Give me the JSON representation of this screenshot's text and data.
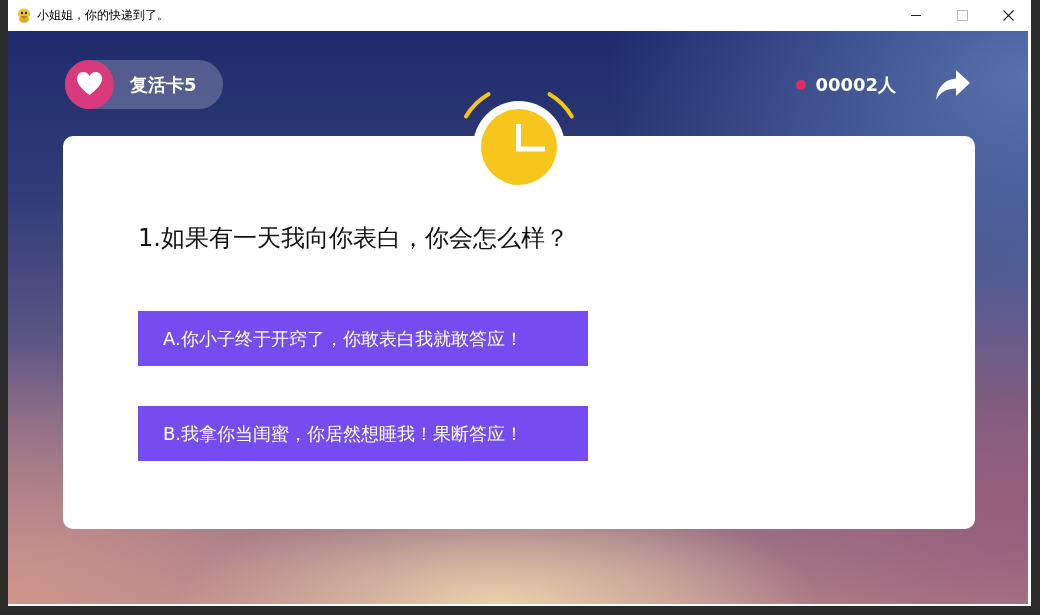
{
  "window": {
    "title": "小姐姐，你的快递到了。"
  },
  "header": {
    "revive_cards": "复活卡5",
    "player_count": "00002人"
  },
  "question": {
    "text": "1.如果有一天我向你表白，你会怎么样？"
  },
  "options": [
    {
      "label": "A.你小子终于开窍了，你敢表白我就敢答应！"
    },
    {
      "label": "B.我拿你当闺蜜，你居然想睡我！果断答应！"
    }
  ]
}
